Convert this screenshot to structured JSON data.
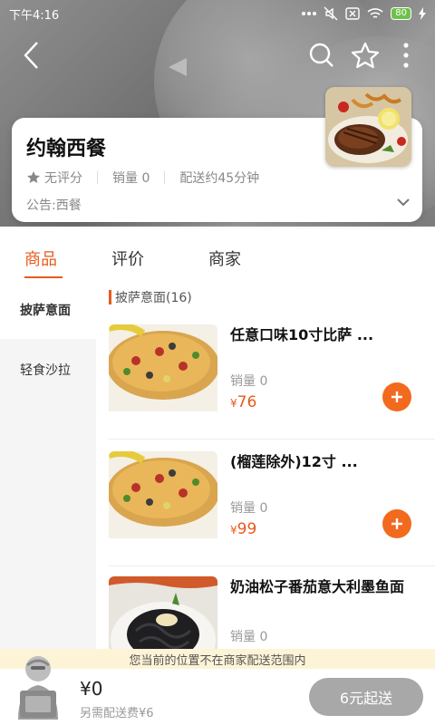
{
  "status_bar": {
    "time": "下午4:16",
    "battery": "80"
  },
  "colors": {
    "accent": "#e85a1c",
    "add_button": "#f26a1e",
    "checkout_disabled": "#a8a8a8",
    "warning_bg": "#fdf3d6"
  },
  "nav": {
    "back_icon": "back-arrow-icon",
    "search_icon": "search-icon",
    "favorite_icon": "star-icon",
    "more_icon": "more-vertical-icon"
  },
  "shop": {
    "name": "约翰西餐",
    "rating": "无评分",
    "sales": "销量 0",
    "delivery_time": "配送约45分钟",
    "notice": "公告:西餐"
  },
  "tabs": [
    {
      "label": "商品",
      "active": true
    },
    {
      "label": "评价",
      "active": false
    },
    {
      "label": "商家",
      "active": false
    }
  ],
  "sidebar": {
    "items": [
      {
        "label": "披萨意面",
        "active": true
      },
      {
        "label": "轻食沙拉",
        "active": false
      }
    ]
  },
  "category": {
    "title": "披萨意面(16)"
  },
  "items": [
    {
      "title": "任意口味10寸比萨 ...",
      "sales": "销量 0",
      "currency": "¥",
      "price": "76",
      "img_caption": "10寸超级豪华比萨"
    },
    {
      "title": "(榴莲除外)12寸 ...",
      "sales": "销量 0",
      "currency": "¥",
      "price": "99",
      "img_caption": "10寸超级豪华比萨"
    },
    {
      "title": "奶油松子番茄意大利墨鱼面",
      "sales": "销量 0",
      "currency": "¥",
      "price": ""
    }
  ],
  "warning": "您当前的位置不在商家配送范围内",
  "cart": {
    "total": "¥0",
    "delivery_fee": "另需配送费¥6",
    "checkout": "6元起送"
  }
}
